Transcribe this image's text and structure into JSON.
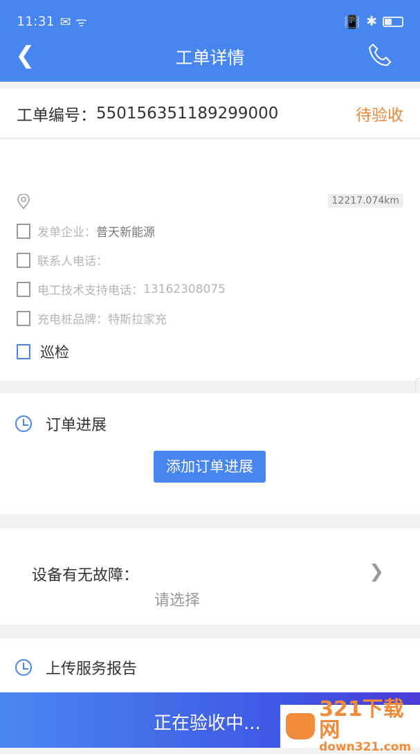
{
  "status_bar": {
    "time": "11:31"
  },
  "header": {
    "title": "工单详情",
    "back_icon": "chevron-left-icon",
    "phone_icon": "phone-icon"
  },
  "order": {
    "label": "工单编号：",
    "number": "550156351189299000",
    "status": "待验收",
    "status_color": "#f0883a"
  },
  "details": {
    "distance": "12217.074km",
    "rows": [
      {
        "label": "发单企业：",
        "value": "普天新能源"
      },
      {
        "label": "联系人电话：",
        "value": ""
      },
      {
        "label": "电工技术支持电话：",
        "value": "13162308075"
      },
      {
        "label": "充电桩品牌：",
        "value": "特斯拉家充"
      }
    ],
    "type": "巡检"
  },
  "progress": {
    "title": "订单进展",
    "add_button": "添加订单进展"
  },
  "fault": {
    "label": "设备有无故障：",
    "placeholder": "请选择"
  },
  "report": {
    "title": "上传服务报告"
  },
  "bottom": {
    "label": "正在验收中..."
  },
  "watermark": {
    "line1": "321下载网",
    "line2": "down321.com"
  },
  "colors": {
    "primary": "#4786f1"
  }
}
